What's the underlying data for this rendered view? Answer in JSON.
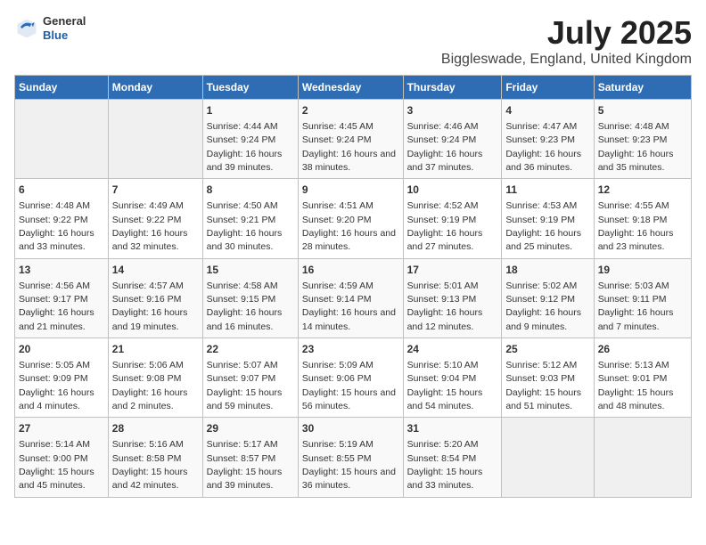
{
  "logo": {
    "general": "General",
    "blue": "Blue"
  },
  "title": "July 2025",
  "subtitle": "Biggleswade, England, United Kingdom",
  "days_header": [
    "Sunday",
    "Monday",
    "Tuesday",
    "Wednesday",
    "Thursday",
    "Friday",
    "Saturday"
  ],
  "weeks": [
    [
      {
        "day": "",
        "info": ""
      },
      {
        "day": "",
        "info": ""
      },
      {
        "day": "1",
        "info": "Sunrise: 4:44 AM\nSunset: 9:24 PM\nDaylight: 16 hours and 39 minutes."
      },
      {
        "day": "2",
        "info": "Sunrise: 4:45 AM\nSunset: 9:24 PM\nDaylight: 16 hours and 38 minutes."
      },
      {
        "day": "3",
        "info": "Sunrise: 4:46 AM\nSunset: 9:24 PM\nDaylight: 16 hours and 37 minutes."
      },
      {
        "day": "4",
        "info": "Sunrise: 4:47 AM\nSunset: 9:23 PM\nDaylight: 16 hours and 36 minutes."
      },
      {
        "day": "5",
        "info": "Sunrise: 4:48 AM\nSunset: 9:23 PM\nDaylight: 16 hours and 35 minutes."
      }
    ],
    [
      {
        "day": "6",
        "info": "Sunrise: 4:48 AM\nSunset: 9:22 PM\nDaylight: 16 hours and 33 minutes."
      },
      {
        "day": "7",
        "info": "Sunrise: 4:49 AM\nSunset: 9:22 PM\nDaylight: 16 hours and 32 minutes."
      },
      {
        "day": "8",
        "info": "Sunrise: 4:50 AM\nSunset: 9:21 PM\nDaylight: 16 hours and 30 minutes."
      },
      {
        "day": "9",
        "info": "Sunrise: 4:51 AM\nSunset: 9:20 PM\nDaylight: 16 hours and 28 minutes."
      },
      {
        "day": "10",
        "info": "Sunrise: 4:52 AM\nSunset: 9:19 PM\nDaylight: 16 hours and 27 minutes."
      },
      {
        "day": "11",
        "info": "Sunrise: 4:53 AM\nSunset: 9:19 PM\nDaylight: 16 hours and 25 minutes."
      },
      {
        "day": "12",
        "info": "Sunrise: 4:55 AM\nSunset: 9:18 PM\nDaylight: 16 hours and 23 minutes."
      }
    ],
    [
      {
        "day": "13",
        "info": "Sunrise: 4:56 AM\nSunset: 9:17 PM\nDaylight: 16 hours and 21 minutes."
      },
      {
        "day": "14",
        "info": "Sunrise: 4:57 AM\nSunset: 9:16 PM\nDaylight: 16 hours and 19 minutes."
      },
      {
        "day": "15",
        "info": "Sunrise: 4:58 AM\nSunset: 9:15 PM\nDaylight: 16 hours and 16 minutes."
      },
      {
        "day": "16",
        "info": "Sunrise: 4:59 AM\nSunset: 9:14 PM\nDaylight: 16 hours and 14 minutes."
      },
      {
        "day": "17",
        "info": "Sunrise: 5:01 AM\nSunset: 9:13 PM\nDaylight: 16 hours and 12 minutes."
      },
      {
        "day": "18",
        "info": "Sunrise: 5:02 AM\nSunset: 9:12 PM\nDaylight: 16 hours and 9 minutes."
      },
      {
        "day": "19",
        "info": "Sunrise: 5:03 AM\nSunset: 9:11 PM\nDaylight: 16 hours and 7 minutes."
      }
    ],
    [
      {
        "day": "20",
        "info": "Sunrise: 5:05 AM\nSunset: 9:09 PM\nDaylight: 16 hours and 4 minutes."
      },
      {
        "day": "21",
        "info": "Sunrise: 5:06 AM\nSunset: 9:08 PM\nDaylight: 16 hours and 2 minutes."
      },
      {
        "day": "22",
        "info": "Sunrise: 5:07 AM\nSunset: 9:07 PM\nDaylight: 15 hours and 59 minutes."
      },
      {
        "day": "23",
        "info": "Sunrise: 5:09 AM\nSunset: 9:06 PM\nDaylight: 15 hours and 56 minutes."
      },
      {
        "day": "24",
        "info": "Sunrise: 5:10 AM\nSunset: 9:04 PM\nDaylight: 15 hours and 54 minutes."
      },
      {
        "day": "25",
        "info": "Sunrise: 5:12 AM\nSunset: 9:03 PM\nDaylight: 15 hours and 51 minutes."
      },
      {
        "day": "26",
        "info": "Sunrise: 5:13 AM\nSunset: 9:01 PM\nDaylight: 15 hours and 48 minutes."
      }
    ],
    [
      {
        "day": "27",
        "info": "Sunrise: 5:14 AM\nSunset: 9:00 PM\nDaylight: 15 hours and 45 minutes."
      },
      {
        "day": "28",
        "info": "Sunrise: 5:16 AM\nSunset: 8:58 PM\nDaylight: 15 hours and 42 minutes."
      },
      {
        "day": "29",
        "info": "Sunrise: 5:17 AM\nSunset: 8:57 PM\nDaylight: 15 hours and 39 minutes."
      },
      {
        "day": "30",
        "info": "Sunrise: 5:19 AM\nSunset: 8:55 PM\nDaylight: 15 hours and 36 minutes."
      },
      {
        "day": "31",
        "info": "Sunrise: 5:20 AM\nSunset: 8:54 PM\nDaylight: 15 hours and 33 minutes."
      },
      {
        "day": "",
        "info": ""
      },
      {
        "day": "",
        "info": ""
      }
    ]
  ]
}
